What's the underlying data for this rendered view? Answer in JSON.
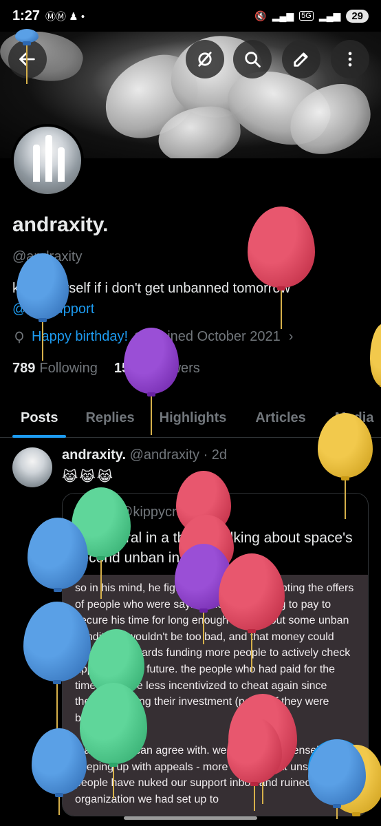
{
  "status_bar": {
    "time": "1:27",
    "left_icons": "ⓂⓂ ♟ •",
    "network": "5G",
    "battery": "29"
  },
  "profile": {
    "name": "andraxity.",
    "handle": "@andraxity",
    "bio_text": "killing myself if i don't get unbanned tomorrow",
    "bio_mention": "@osusupport",
    "birthday": "Happy birthday!",
    "joined": "Joined October 2021",
    "following_count": "789",
    "following_label": "Following",
    "followers_count": "159",
    "followers_label": "Followers"
  },
  "tabs": [
    "Posts",
    "Replies",
    "Highlights",
    "Articles",
    "Media"
  ],
  "post": {
    "name": "andraxity.",
    "handle_time": "@andraxity · 2d",
    "emojis": "😹😹😹",
    "quote": {
      "name": "kip",
      "handle_time": "@kippycraft · 2d",
      "text": "ephemeral in a thread talking about space's second unban in 2016",
      "image_paragraphs": [
        "so in his mind, he figured that maybe accepting the offers of people who were saying they'd be willing to pay to secure his time for long enough to work out some unban conditions wouldn't be too bad, and that money could ideally go towards funding more people to actively check appeals in the future. the people who had paid for the time would be less incentivized to cheat again since they'd be losing their investment (perse) if they were banned again.",
        "that much, i can agree with. we struggle immensely with keeping up with appeals - more so now that unscrupulous people have nuked our support inbox and ruined all of the organization we had set up to"
      ]
    }
  },
  "fab_icon": "plus-icon",
  "colors": {
    "accent": "#1d9bf0",
    "background": "#000000",
    "text": "#e7e9ea",
    "muted": "#71767b"
  }
}
